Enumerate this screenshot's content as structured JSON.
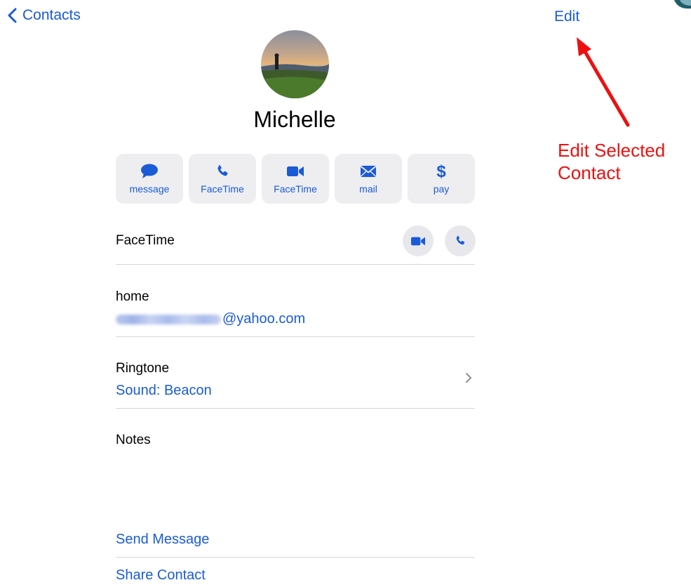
{
  "nav": {
    "back_label": "Contacts",
    "edit_label": "Edit"
  },
  "contact": {
    "name": "Michelle",
    "actions": [
      {
        "label": "message",
        "icon": "message-bubble-icon"
      },
      {
        "label": "FaceTime",
        "icon": "phone-icon"
      },
      {
        "label": "FaceTime",
        "icon": "video-camera-icon"
      },
      {
        "label": "mail",
        "icon": "envelope-icon"
      },
      {
        "label": "pay",
        "icon": "dollar-icon"
      }
    ],
    "facetime_label": "FaceTime",
    "email": {
      "label": "home",
      "value_suffix": "@yahoo.com"
    },
    "ringtone": {
      "label": "Ringtone",
      "value": "Sound: Beacon"
    },
    "notes_label": "Notes",
    "links": {
      "send_message": "Send Message",
      "share_contact": "Share Contact"
    }
  },
  "annotation": {
    "line1": "Edit Selected",
    "line2": "Contact",
    "color": "#ee1010"
  },
  "colors": {
    "accent": "#1a5bd6",
    "button_bg": "#eeeef1",
    "separator": "#d6d6da"
  }
}
